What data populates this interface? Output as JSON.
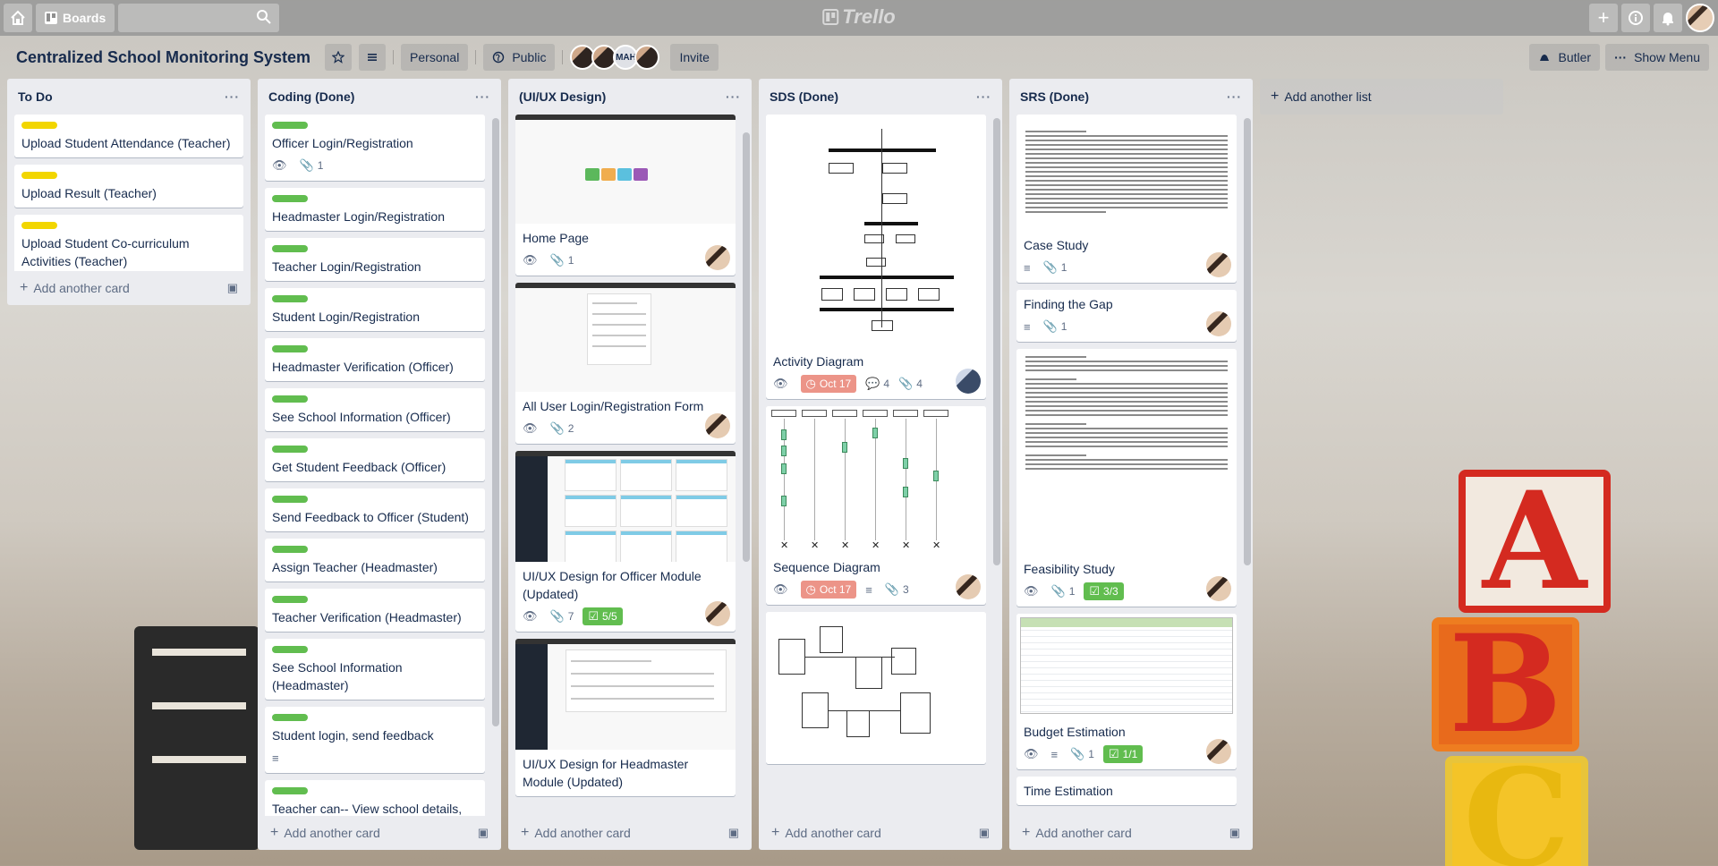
{
  "header": {
    "boards_label": "Boards",
    "logo_text": "Trello"
  },
  "board": {
    "title": "Centralized School Monitoring System",
    "team_label": "Personal",
    "visibility_label": "Public",
    "member_initials": "MAH",
    "invite_label": "Invite",
    "butler_label": "Butler",
    "show_menu_label": "Show Menu"
  },
  "colors": {
    "label_yellow": "#f2d600",
    "label_green": "#61bd4f",
    "due_badge": "#ec9488",
    "list_bg": "#ebecf0"
  },
  "add_card_label": "Add another card",
  "add_list_label": "Add another list",
  "lists": [
    {
      "title": "To Do",
      "cards": [
        {
          "title": "Upload Student Attendance (Teacher)"
        },
        {
          "title": "Upload Result (Teacher)"
        },
        {
          "title": "Upload Student Co-curriculum Activities (Teacher)"
        }
      ]
    },
    {
      "title": "Coding (Done)",
      "cards": [
        {
          "title": "Officer Login/Registration",
          "attachments": "1"
        },
        {
          "title": "Headmaster Login/Registration"
        },
        {
          "title": "Teacher Login/Registration"
        },
        {
          "title": "Student Login/Registration"
        },
        {
          "title": "Headmaster Verification (Officer)"
        },
        {
          "title": "See School Information (Officer)"
        },
        {
          "title": "Get Student Feedback (Officer)"
        },
        {
          "title": "Send Feedback to Officer (Student)"
        },
        {
          "title": "Assign Teacher (Headmaster)"
        },
        {
          "title": "Teacher Verification (Headmaster)"
        },
        {
          "title": "See School Information (Headmaster)"
        },
        {
          "title": "Student login, send feedback"
        },
        {
          "title": "Teacher can-- View school details, add students, update result, take attendance"
        }
      ]
    },
    {
      "title": "(UI/UX Design)",
      "cards": [
        {
          "title": "Home Page",
          "attachments": "1"
        },
        {
          "title": "All User Login/Registration Form",
          "attachments": "2"
        },
        {
          "title": "UI/UX Design for Officer Module (Updated)",
          "attachments": "7",
          "checklist": "5/5"
        },
        {
          "title": "UI/UX Design for Headmaster Module (Updated)"
        }
      ]
    },
    {
      "title": "SDS (Done)",
      "cards": [
        {
          "title": "Activity Diagram",
          "due": "Oct 17",
          "comments": "4",
          "attachments": "4"
        },
        {
          "title": "Sequence Diagram",
          "due": "Oct 17",
          "attachments": "3"
        }
      ]
    },
    {
      "title": "SRS (Done)",
      "cards": [
        {
          "title": "Case Study",
          "attachments": "1"
        },
        {
          "title": "Finding the Gap",
          "attachments": "1"
        },
        {
          "title": "Feasibility Study",
          "attachments": "1",
          "checklist": "3/3"
        },
        {
          "title": "Budget Estimation",
          "attachments": "1",
          "checklist": "1/1"
        },
        {
          "title": "Time Estimation"
        }
      ]
    }
  ]
}
